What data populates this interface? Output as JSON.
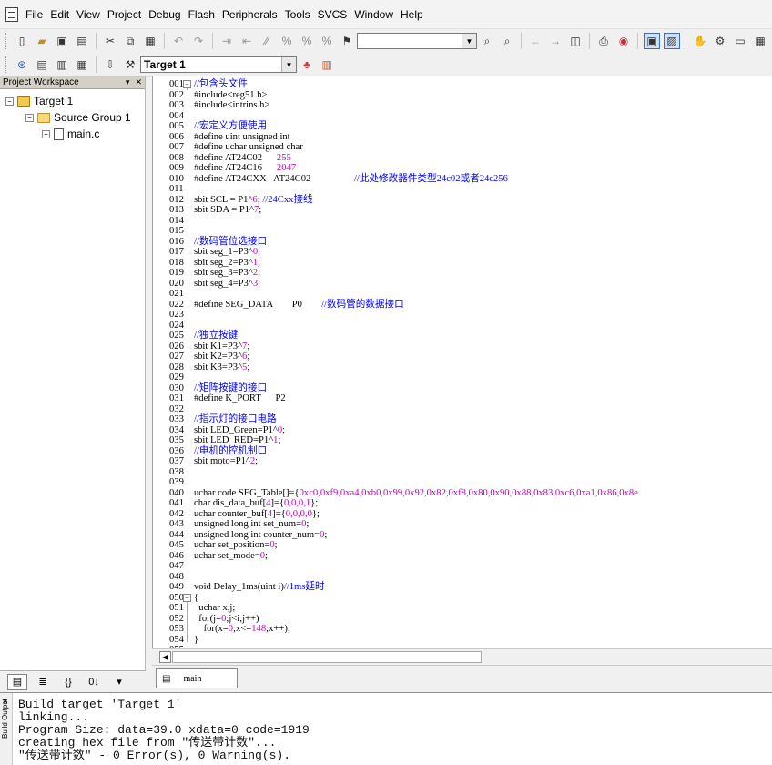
{
  "menu": {
    "items": [
      "File",
      "Edit",
      "View",
      "Project",
      "Debug",
      "Flash",
      "Peripherals",
      "Tools",
      "SVCS",
      "Window",
      "Help"
    ]
  },
  "toolbar": {
    "find_combo_value": "",
    "target_combo_value": "Target 1"
  },
  "project": {
    "header": "Project Workspace",
    "tree": {
      "target": "Target 1",
      "group": "Source Group 1",
      "file": "main.c"
    }
  },
  "editor": {
    "tab_label": "main",
    "lines": [
      {
        "n": "001",
        "fold": "⊟",
        "segs": [
          [
            "//包含头文件",
            "c"
          ]
        ]
      },
      {
        "n": "002",
        "segs": [
          [
            "#include<reg51.h>",
            "k"
          ]
        ]
      },
      {
        "n": "003",
        "segs": [
          [
            "#include<intrins.h>",
            "k"
          ]
        ]
      },
      {
        "n": "004",
        "segs": []
      },
      {
        "n": "005",
        "segs": [
          [
            "//宏定义方便使用",
            "c"
          ]
        ]
      },
      {
        "n": "006",
        "segs": [
          [
            "#define uint unsigned int",
            "k"
          ]
        ]
      },
      {
        "n": "007",
        "segs": [
          [
            "#define uchar unsigned char",
            "k"
          ]
        ]
      },
      {
        "n": "008",
        "segs": [
          [
            "#define AT24C02      ",
            "k"
          ],
          [
            "255",
            "n"
          ]
        ]
      },
      {
        "n": "009",
        "segs": [
          [
            "#define AT24C16      ",
            "k"
          ],
          [
            "2047",
            "n"
          ]
        ]
      },
      {
        "n": "010",
        "segs": [
          [
            "#define AT24CXX   AT24C02                  ",
            "k"
          ],
          [
            "//此处修改器件类型24c02或者24c256",
            "c"
          ]
        ]
      },
      {
        "n": "011",
        "segs": []
      },
      {
        "n": "012",
        "segs": [
          [
            "sbit SCL = P1^",
            "k"
          ],
          [
            "6",
            "n"
          ],
          [
            "; ",
            "k"
          ],
          [
            "//24Cxx接线",
            "c"
          ]
        ]
      },
      {
        "n": "013",
        "segs": [
          [
            "sbit SDA = P1^",
            "k"
          ],
          [
            "7",
            "n"
          ],
          [
            ";",
            "k"
          ]
        ]
      },
      {
        "n": "014",
        "segs": []
      },
      {
        "n": "015",
        "segs": []
      },
      {
        "n": "016",
        "segs": [
          [
            "//数码管位选接口",
            "c"
          ]
        ]
      },
      {
        "n": "017",
        "segs": [
          [
            "sbit seg_1=P3^",
            "k"
          ],
          [
            "0",
            "n"
          ],
          [
            ";",
            "k"
          ]
        ]
      },
      {
        "n": "018",
        "segs": [
          [
            "sbit seg_2=P3^",
            "k"
          ],
          [
            "1",
            "n"
          ],
          [
            ";",
            "k"
          ]
        ]
      },
      {
        "n": "019",
        "segs": [
          [
            "sbit seg_3=P3^",
            "k"
          ],
          [
            "2",
            "n"
          ],
          [
            ";",
            "k"
          ]
        ]
      },
      {
        "n": "020",
        "segs": [
          [
            "sbit seg_4=P3^",
            "k"
          ],
          [
            "3",
            "n"
          ],
          [
            ";",
            "k"
          ]
        ]
      },
      {
        "n": "021",
        "segs": []
      },
      {
        "n": "022",
        "segs": [
          [
            "#define SEG_DATA        P0        ",
            "k"
          ],
          [
            "//数码管的数据接口",
            "c"
          ]
        ]
      },
      {
        "n": "023",
        "segs": []
      },
      {
        "n": "024",
        "segs": []
      },
      {
        "n": "025",
        "segs": [
          [
            "//独立按键",
            "c"
          ]
        ]
      },
      {
        "n": "026",
        "segs": [
          [
            "sbit K1=P3^",
            "k"
          ],
          [
            "7",
            "n"
          ],
          [
            ";",
            "k"
          ]
        ]
      },
      {
        "n": "027",
        "segs": [
          [
            "sbit K2=P3^",
            "k"
          ],
          [
            "6",
            "n"
          ],
          [
            ";",
            "k"
          ]
        ]
      },
      {
        "n": "028",
        "segs": [
          [
            "sbit K3=P3^",
            "k"
          ],
          [
            "5",
            "n"
          ],
          [
            ";",
            "k"
          ]
        ]
      },
      {
        "n": "029",
        "segs": []
      },
      {
        "n": "030",
        "segs": [
          [
            "//矩阵按键的接口",
            "c"
          ]
        ]
      },
      {
        "n": "031",
        "segs": [
          [
            "#define K_PORT      P2",
            "k"
          ]
        ]
      },
      {
        "n": "032",
        "segs": []
      },
      {
        "n": "033",
        "segs": [
          [
            "//指示灯的接口电路",
            "c"
          ]
        ]
      },
      {
        "n": "034",
        "segs": [
          [
            "sbit LED_Green=P1^",
            "k"
          ],
          [
            "0",
            "n"
          ],
          [
            ";",
            "k"
          ]
        ]
      },
      {
        "n": "035",
        "segs": [
          [
            "sbit LED_RED=P1^",
            "k"
          ],
          [
            "1",
            "n"
          ],
          [
            ";",
            "k"
          ]
        ]
      },
      {
        "n": "036",
        "segs": [
          [
            "//电机的控机制口",
            "c"
          ]
        ]
      },
      {
        "n": "037",
        "segs": [
          [
            "sbit moto=P1^",
            "k"
          ],
          [
            "2",
            "n"
          ],
          [
            ";",
            "k"
          ]
        ]
      },
      {
        "n": "038",
        "segs": []
      },
      {
        "n": "039",
        "segs": []
      },
      {
        "n": "040",
        "segs": [
          [
            "uchar code SEG_Table[]={",
            "k"
          ],
          [
            "0xc0,0xf9,0xa4,0xb0,0x99,0x92,0x82,0xf8,0x80,0x90,0x88,0x83,0xc6,0xa1,0x86,0x8e",
            "n"
          ]
        ]
      },
      {
        "n": "041",
        "segs": [
          [
            "char dis_data_buf[",
            "k"
          ],
          [
            "4",
            "n"
          ],
          [
            "]={",
            "k"
          ],
          [
            "0,0,0,1",
            "n"
          ],
          [
            "};",
            "k"
          ]
        ]
      },
      {
        "n": "042",
        "segs": [
          [
            "uchar counter_buf[",
            "k"
          ],
          [
            "4",
            "n"
          ],
          [
            "]={",
            "k"
          ],
          [
            "0,0,0,0",
            "n"
          ],
          [
            "};",
            "k"
          ]
        ]
      },
      {
        "n": "043",
        "segs": [
          [
            "unsigned long int set_num=",
            "k"
          ],
          [
            "0",
            "n"
          ],
          [
            ";",
            "k"
          ]
        ]
      },
      {
        "n": "044",
        "segs": [
          [
            "unsigned long int counter_num=",
            "k"
          ],
          [
            "0",
            "n"
          ],
          [
            ";",
            "k"
          ]
        ]
      },
      {
        "n": "045",
        "segs": [
          [
            "uchar set_position=",
            "k"
          ],
          [
            "0",
            "n"
          ],
          [
            ";",
            "k"
          ]
        ]
      },
      {
        "n": "046",
        "segs": [
          [
            "uchar set_mode=",
            "k"
          ],
          [
            "0",
            "n"
          ],
          [
            ";",
            "k"
          ]
        ]
      },
      {
        "n": "047",
        "segs": []
      },
      {
        "n": "048",
        "segs": []
      },
      {
        "n": "049",
        "segs": [
          [
            "void Delay_1ms(uint i)",
            "k"
          ],
          [
            "//1ms延时",
            "c"
          ]
        ]
      },
      {
        "n": "050",
        "fold": "⊟",
        "segs": [
          [
            "{",
            "k"
          ]
        ]
      },
      {
        "n": "051",
        "segs": [
          [
            "  uchar x,j;",
            "k"
          ]
        ]
      },
      {
        "n": "052",
        "segs": [
          [
            "  for(j=",
            "k"
          ],
          [
            "0",
            "n"
          ],
          [
            ";j<i;j++)",
            "k"
          ]
        ]
      },
      {
        "n": "053",
        "segs": [
          [
            "    for(x=",
            "k"
          ],
          [
            "0",
            "n"
          ],
          [
            ";x<=",
            "k"
          ],
          [
            "148",
            "n"
          ],
          [
            ";x++);",
            "k"
          ]
        ]
      },
      {
        "n": "054",
        "segs": [
          [
            "}",
            "k"
          ]
        ]
      },
      {
        "n": "055",
        "segs": []
      }
    ]
  },
  "build": {
    "label": "Build Output",
    "lines": [
      "Build target 'Target 1'",
      "linking...",
      "Program Size: data=39.0 xdata=0 code=1919",
      "creating hex file from \"传送带计数\"...",
      "\"传送带计数\" - 0 Error(s), 0 Warning(s)."
    ]
  },
  "colors": {
    "comment": "#0000ff",
    "number": "#c000c0",
    "text": "#000000"
  }
}
